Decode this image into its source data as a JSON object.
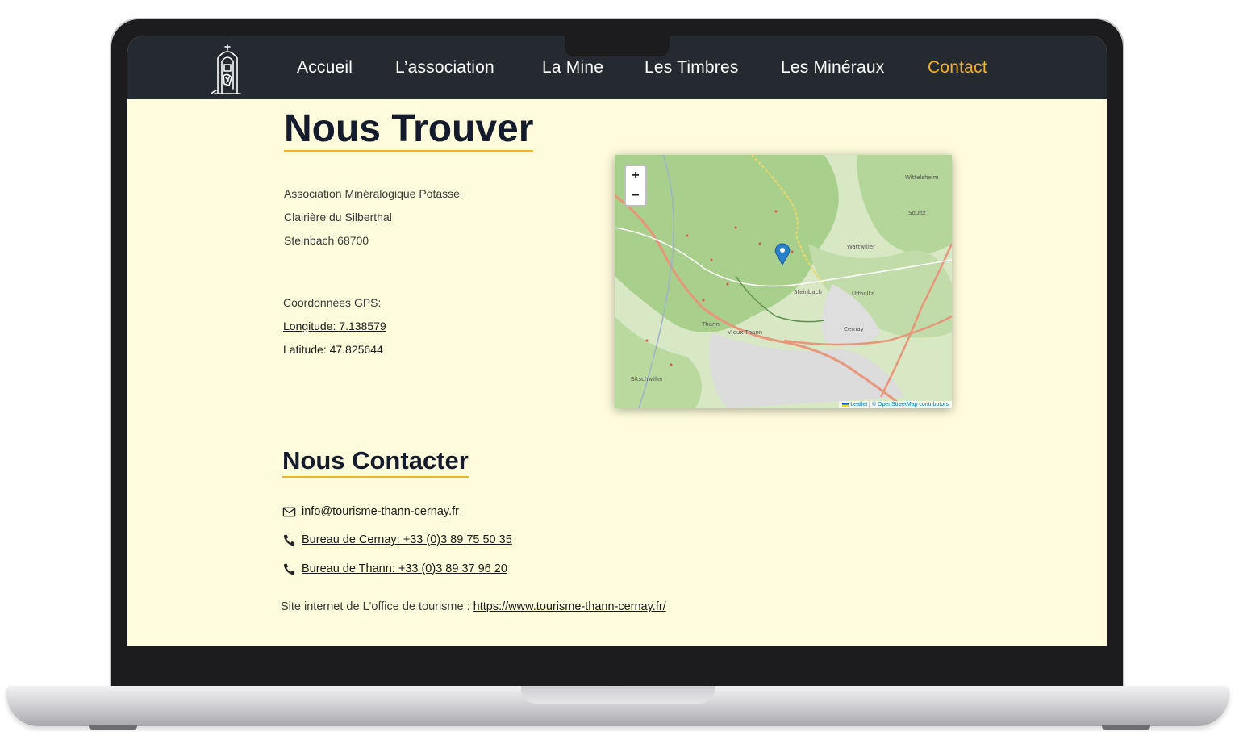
{
  "nav": {
    "items": [
      {
        "label": "Accueil"
      },
      {
        "label": "L’association"
      },
      {
        "label": "La Mine"
      },
      {
        "label": "Les Timbres"
      },
      {
        "label": "Les Minéraux"
      },
      {
        "label": "Contact"
      }
    ],
    "active_color": "#f4b02a"
  },
  "find": {
    "title": "Nous Trouver",
    "address": [
      "Association Minéralogique Potasse",
      "Clairière du Silberthal",
      "Steinbach 68700"
    ],
    "gps_label": "Coordonnées GPS:",
    "longitude": "Longitude: 7.138579",
    "latitude": "Latitude: 47.825644"
  },
  "map": {
    "zoom_in": "+",
    "zoom_out": "−",
    "attribution_leaflet": "Leaflet",
    "attribution_osm": "© OpenStreetMap contributors",
    "places": [
      "Thann",
      "Cernay",
      "Steinbach",
      "Wattwiller",
      "Uffholtz",
      "Vieux-Thann",
      "Bitschwiller",
      "Wittelsheim",
      "Soultz"
    ]
  },
  "contact": {
    "title": "Nous Contacter",
    "email": "info@tourisme-thann-cernay.fr",
    "phone_cernay": "Bureau de Cernay: +33 (0)3 89 75 50 35",
    "phone_thann": "Bureau de Thann: +33 (0)3 89 37 96 20",
    "site_label": "Site internet de L'office de tourisme :",
    "site_url": "https://www.tourisme-thann-cernay.fr/"
  },
  "colors": {
    "accent": "#f1b52d",
    "navbar": "#252a31",
    "page_bg": "#fefcdc"
  }
}
